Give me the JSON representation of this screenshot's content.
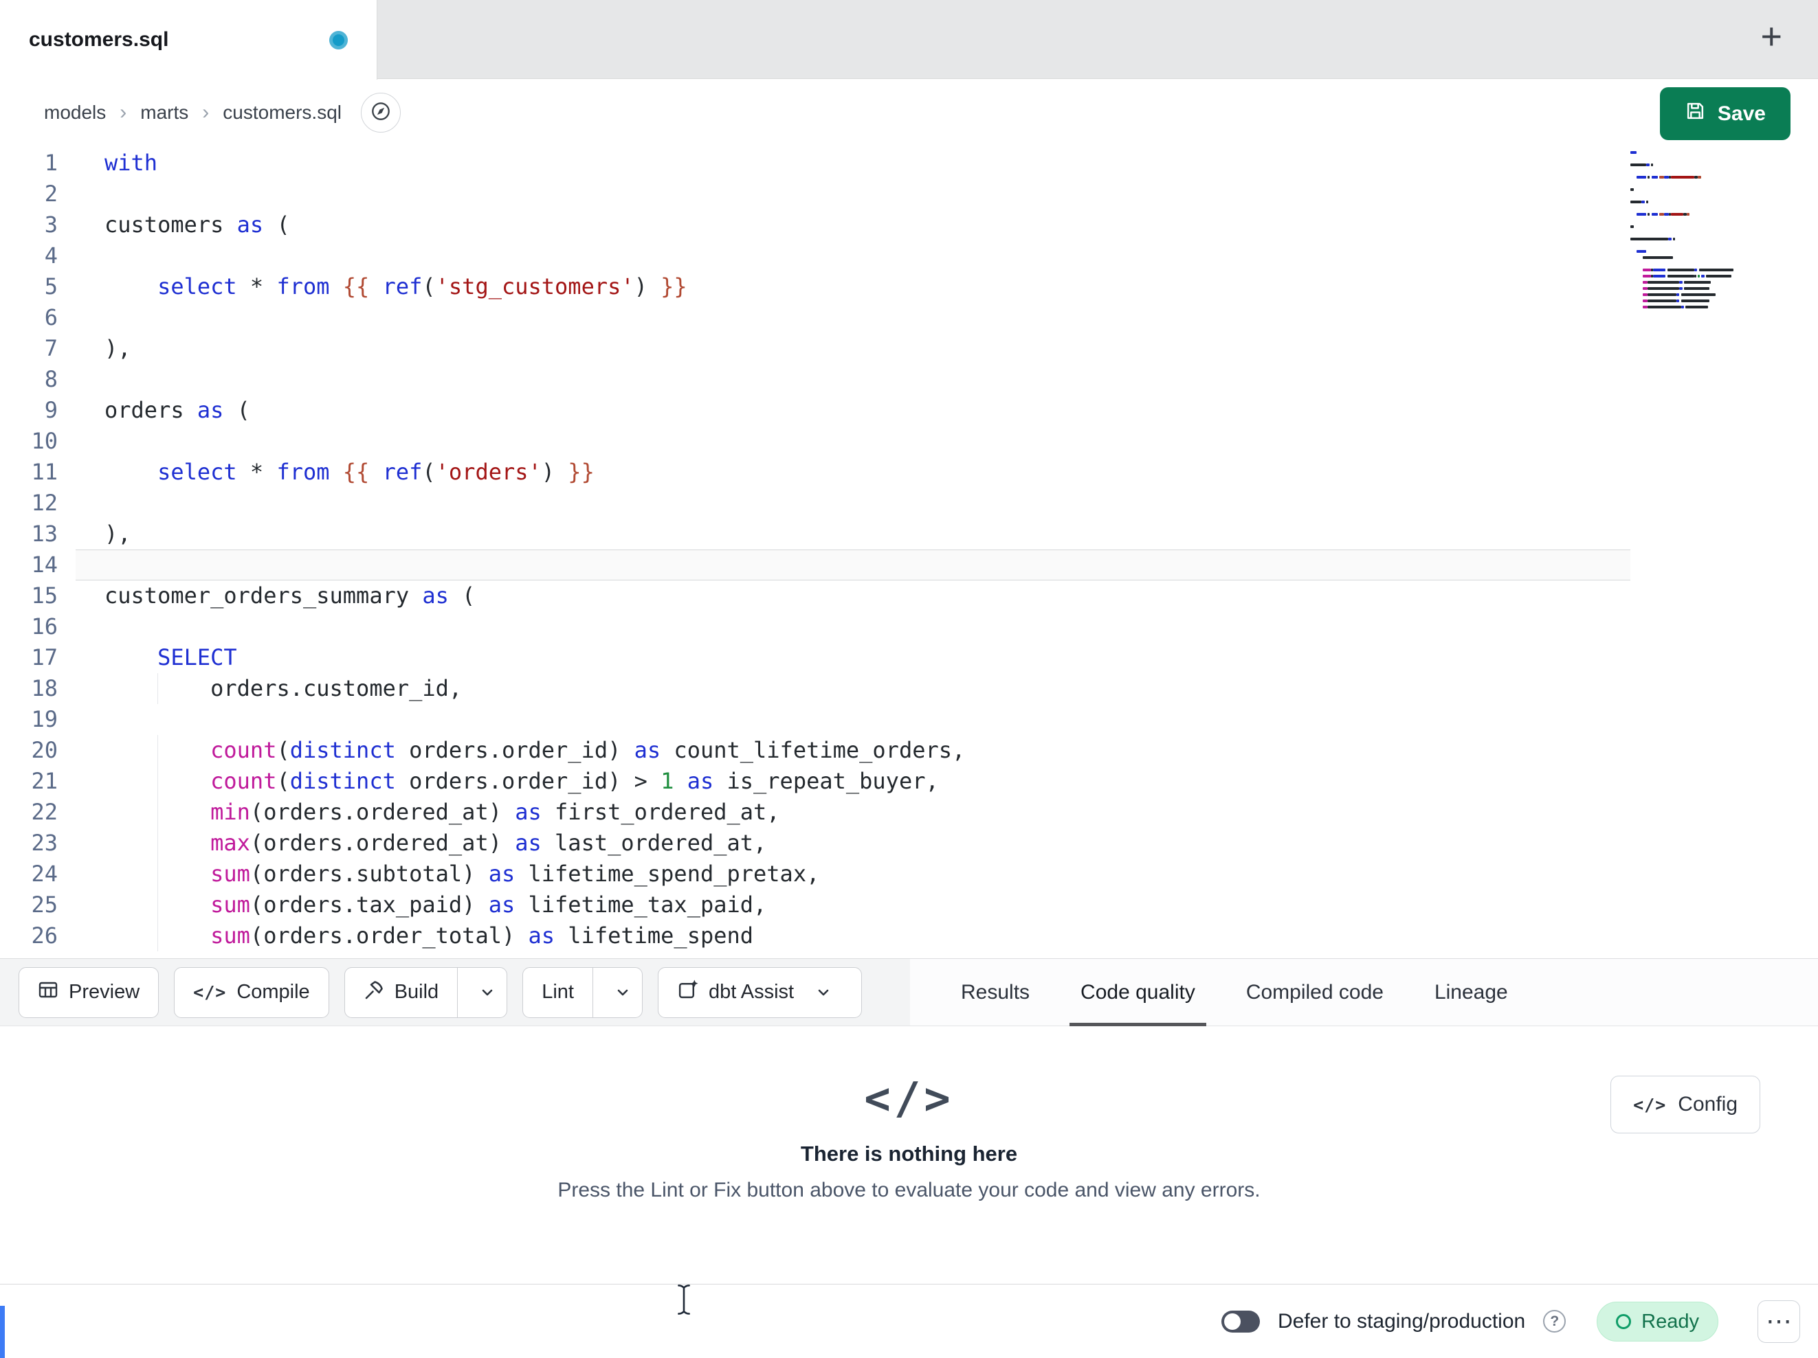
{
  "window": {
    "tab_title": "customers.sql",
    "new_tab_label": "+"
  },
  "breadcrumb": {
    "items": [
      "models",
      "marts",
      "customers.sql"
    ],
    "separator": "›"
  },
  "header": {
    "save_label": "Save"
  },
  "icons": {
    "code_glyph": "</>"
  },
  "colors": {
    "accent_green": "#0a7d54",
    "tab_dot": "#149bc8",
    "active_tab_underline": "#55565a",
    "ready_bg": "#d2f5e1",
    "ready_text": "#11714b",
    "syntax": {
      "kw": "#1e2fd2",
      "fn": "#c01a9b",
      "str": "#a31515",
      "jinja": "#b14a33",
      "num": "#1e8e3e",
      "op": "#24292e",
      "txt": "#24292e",
      "gutter": "#5a6a88"
    }
  },
  "editor": {
    "active_line": 14,
    "lines": [
      {
        "n": 1,
        "segs": [
          [
            "kw",
            "with"
          ]
        ]
      },
      {
        "n": 2,
        "segs": []
      },
      {
        "n": 3,
        "segs": [
          [
            "txt",
            "customers "
          ],
          [
            "kw",
            "as"
          ],
          [
            "txt",
            " ("
          ]
        ]
      },
      {
        "n": 4,
        "segs": []
      },
      {
        "n": 5,
        "segs": [
          [
            "txt",
            "    "
          ],
          [
            "kw",
            "select"
          ],
          [
            "txt",
            " "
          ],
          [
            "op",
            "*"
          ],
          [
            "txt",
            " "
          ],
          [
            "kw",
            "from"
          ],
          [
            "txt",
            " "
          ],
          [
            "jinja",
            "{{ "
          ],
          [
            "kw",
            "ref"
          ],
          [
            "txt",
            "("
          ],
          [
            "str",
            "'stg_customers'"
          ],
          [
            "txt",
            ") "
          ],
          [
            "jinja",
            "}}"
          ]
        ]
      },
      {
        "n": 6,
        "segs": []
      },
      {
        "n": 7,
        "segs": [
          [
            "txt",
            "),"
          ]
        ]
      },
      {
        "n": 8,
        "segs": []
      },
      {
        "n": 9,
        "segs": [
          [
            "txt",
            "orders "
          ],
          [
            "kw",
            "as"
          ],
          [
            "txt",
            " ("
          ]
        ]
      },
      {
        "n": 10,
        "segs": []
      },
      {
        "n": 11,
        "segs": [
          [
            "txt",
            "    "
          ],
          [
            "kw",
            "select"
          ],
          [
            "txt",
            " "
          ],
          [
            "op",
            "*"
          ],
          [
            "txt",
            " "
          ],
          [
            "kw",
            "from"
          ],
          [
            "txt",
            " "
          ],
          [
            "jinja",
            "{{ "
          ],
          [
            "kw",
            "ref"
          ],
          [
            "txt",
            "("
          ],
          [
            "str",
            "'orders'"
          ],
          [
            "txt",
            ") "
          ],
          [
            "jinja",
            "}}"
          ]
        ]
      },
      {
        "n": 12,
        "segs": []
      },
      {
        "n": 13,
        "segs": [
          [
            "txt",
            "),"
          ]
        ]
      },
      {
        "n": 14,
        "segs": []
      },
      {
        "n": 15,
        "segs": [
          [
            "txt",
            "customer_orders_summary "
          ],
          [
            "kw",
            "as"
          ],
          [
            "txt",
            " ("
          ]
        ]
      },
      {
        "n": 16,
        "segs": []
      },
      {
        "n": 17,
        "segs": [
          [
            "txt",
            "    "
          ],
          [
            "kw",
            "SELECT"
          ]
        ]
      },
      {
        "n": 18,
        "segs": [
          [
            "txt",
            "        orders.customer_id,"
          ]
        ]
      },
      {
        "n": 19,
        "segs": []
      },
      {
        "n": 20,
        "segs": [
          [
            "txt",
            "        "
          ],
          [
            "fn",
            "count"
          ],
          [
            "txt",
            "("
          ],
          [
            "kw",
            "distinct"
          ],
          [
            "txt",
            " orders.order_id) "
          ],
          [
            "kw",
            "as"
          ],
          [
            "txt",
            " count_lifetime_orders,"
          ]
        ]
      },
      {
        "n": 21,
        "segs": [
          [
            "txt",
            "        "
          ],
          [
            "fn",
            "count"
          ],
          [
            "txt",
            "("
          ],
          [
            "kw",
            "distinct"
          ],
          [
            "txt",
            " orders.order_id) "
          ],
          [
            "op",
            ">"
          ],
          [
            "txt",
            " "
          ],
          [
            "num",
            "1"
          ],
          [
            "txt",
            " "
          ],
          [
            "kw",
            "as"
          ],
          [
            "txt",
            " is_repeat_buyer,"
          ]
        ]
      },
      {
        "n": 22,
        "segs": [
          [
            "txt",
            "        "
          ],
          [
            "fn",
            "min"
          ],
          [
            "txt",
            "(orders.ordered_at) "
          ],
          [
            "kw",
            "as"
          ],
          [
            "txt",
            " first_ordered_at,"
          ]
        ]
      },
      {
        "n": 23,
        "segs": [
          [
            "txt",
            "        "
          ],
          [
            "fn",
            "max"
          ],
          [
            "txt",
            "(orders.ordered_at) "
          ],
          [
            "kw",
            "as"
          ],
          [
            "txt",
            " last_ordered_at,"
          ]
        ]
      },
      {
        "n": 24,
        "segs": [
          [
            "txt",
            "        "
          ],
          [
            "fn",
            "sum"
          ],
          [
            "txt",
            "(orders.subtotal) "
          ],
          [
            "kw",
            "as"
          ],
          [
            "txt",
            " lifetime_spend_pretax,"
          ]
        ]
      },
      {
        "n": 25,
        "segs": [
          [
            "txt",
            "        "
          ],
          [
            "fn",
            "sum"
          ],
          [
            "txt",
            "(orders.tax_paid) "
          ],
          [
            "kw",
            "as"
          ],
          [
            "txt",
            " lifetime_tax_paid,"
          ]
        ]
      },
      {
        "n": 26,
        "segs": [
          [
            "txt",
            "        "
          ],
          [
            "fn",
            "sum"
          ],
          [
            "txt",
            "(orders.order_total) "
          ],
          [
            "kw",
            "as"
          ],
          [
            "txt",
            " lifetime_spend"
          ]
        ]
      }
    ]
  },
  "toolbar": {
    "preview_label": "Preview",
    "compile_label": "Compile",
    "build_label": "Build",
    "lint_label": "Lint",
    "assist_label": "dbt Assist"
  },
  "panel_tabs": {
    "items": [
      {
        "label": "Results",
        "active": false
      },
      {
        "label": "Code quality",
        "active": true
      },
      {
        "label": "Compiled code",
        "active": false
      },
      {
        "label": "Lineage",
        "active": false
      }
    ]
  },
  "empty_state": {
    "title": "There is nothing here",
    "subtitle": "Press the Lint or Fix button above to evaluate your code and view any errors.",
    "config_label": "Config"
  },
  "statusbar": {
    "defer_label": "Defer to staging/production",
    "help_label": "?",
    "ready_label": "Ready",
    "more_label": "⋯"
  }
}
